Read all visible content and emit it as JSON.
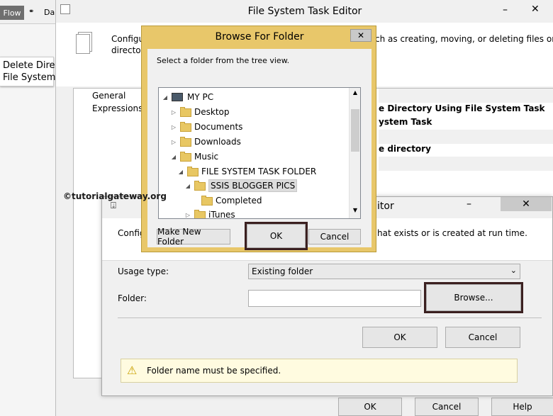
{
  "background_app": {
    "tab_flow": "Flow",
    "tab_data": "Da",
    "task_label_line1": "Delete Direc",
    "task_label_line2": "File System"
  },
  "editor": {
    "title": "File System Task Editor",
    "description_visible_start": "Configu",
    "description_visible_line2": "director",
    "description_visible_end": "ch as creating, moving, or deleting files or",
    "nav_items": [
      "General",
      "Expressions"
    ],
    "grid_values": {
      "name": "e Directory Using File System Task",
      "description": "ystem Task",
      "operation": "e directory"
    },
    "buttons": {
      "ok": "OK",
      "cancel": "Cancel",
      "help": "Help"
    }
  },
  "connection_editor": {
    "title_visible": "itor",
    "description_left": "Config",
    "description_right": "hat exists or is created at run time.",
    "usage_type_label": "Usage type:",
    "usage_type_value": "Existing folder",
    "folder_label": "Folder:",
    "folder_value": "",
    "browse_button": "Browse...",
    "ok_button": "OK",
    "cancel_button": "Cancel",
    "warning_text": "Folder name must be specified."
  },
  "browse_dialog": {
    "title": "Browse For Folder",
    "instruction": "Select a folder from the tree view.",
    "tree": [
      {
        "label": "MY PC",
        "expanded": true,
        "level": 0
      },
      {
        "label": "Desktop",
        "expanded": false,
        "level": 1
      },
      {
        "label": "Documents",
        "expanded": false,
        "level": 1
      },
      {
        "label": "Downloads",
        "expanded": false,
        "level": 1
      },
      {
        "label": "Music",
        "expanded": true,
        "level": 1
      },
      {
        "label": "FILE SYSTEM TASK FOLDER",
        "expanded": true,
        "level": 2
      },
      {
        "label": "SSIS BLOGGER PICS",
        "expanded": true,
        "level": 3,
        "selected": true
      },
      {
        "label": "Completed",
        "level": 4
      },
      {
        "label": "iTunes",
        "expanded": false,
        "level": 3
      }
    ],
    "buttons": {
      "new_folder": "Make New Folder",
      "ok": "OK",
      "cancel": "Cancel"
    }
  },
  "watermark": "©tutorialgateway.org",
  "colors": {
    "dialog_frame": "#e8c76a",
    "close_button": "#c9c9c9",
    "highlight_box": "#3b2020",
    "warning_bg": "#fffbe0",
    "selected_item": "#dcdcdc"
  }
}
